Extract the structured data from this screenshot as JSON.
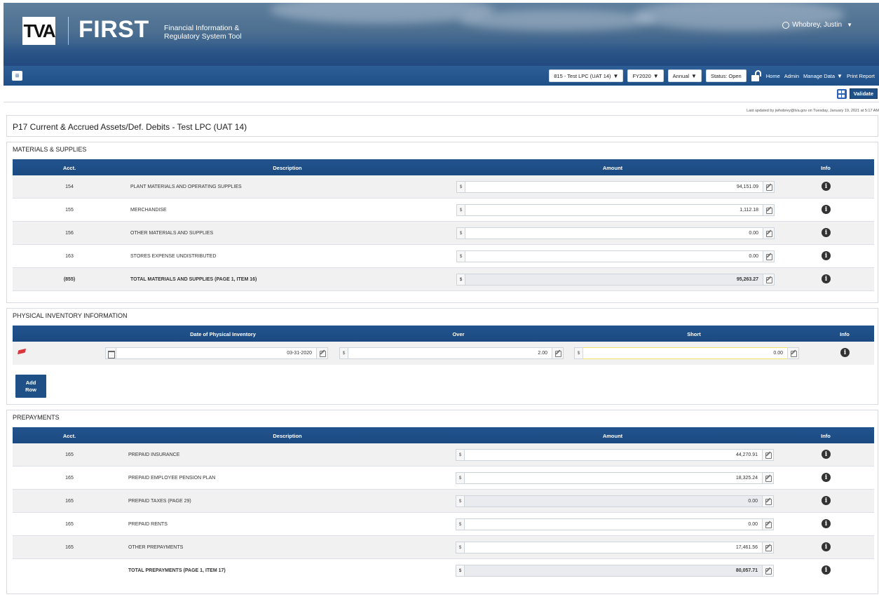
{
  "header": {
    "logo_tva": "TVA",
    "logo_first": "FIRST",
    "subtitle": "Financial Information & Regulatory System Tool",
    "user_name": "Whobrey, Justin"
  },
  "nav": {
    "entity": "815 - Test LPC (UAT 14)",
    "fiscal_year": "FY2020",
    "period": "Annual",
    "status": "Status: Open",
    "links": [
      "Home",
      "Admin",
      "Manage Data",
      "Print Report"
    ]
  },
  "toolbar": {
    "validate_label": "Validate"
  },
  "last_updated": "Last updated by jwhobrey@tva.gov on Tuesday, January 19, 2021 at 5:17 AM",
  "page_title": "P17 Current & Accrued Assets/Def. Debits - Test LPC (UAT 14)",
  "materials": {
    "title": "MATERIALS & SUPPLIES",
    "headers": {
      "acct": "Acct.",
      "desc": "Description",
      "amount": "Amount",
      "info": "Info"
    },
    "rows": [
      {
        "acct": "154",
        "desc": "PLANT MATERIALS AND OPERATING SUPPLIES",
        "amount": "94,151.09"
      },
      {
        "acct": "155",
        "desc": "MERCHANDISE",
        "amount": "1,112.18"
      },
      {
        "acct": "156",
        "desc": "OTHER MATERIALS AND SUPPLIES",
        "amount": "0.00"
      },
      {
        "acct": "163",
        "desc": "STORES EXPENSE UNDISTRIBUTED",
        "amount": "0.00"
      },
      {
        "acct": "(855)",
        "desc": "TOTAL MATERIALS AND SUPPLIES (PAGE 1, ITEM 16)",
        "amount": "95,263.27"
      }
    ],
    "currency": "$"
  },
  "inventory": {
    "title": "PHYSICAL INVENTORY INFORMATION",
    "headers": {
      "date": "Date of Physical Inventory",
      "over": "Over",
      "short": "Short",
      "info": "Info"
    },
    "row": {
      "date": "03-31-2020",
      "over": "2.00",
      "short": "0.00"
    },
    "add_row_line1": "Add",
    "add_row_line2": "Row"
  },
  "prepayments": {
    "title": "PREPAYMENTS",
    "headers": {
      "acct": "Acct.",
      "desc": "Description",
      "amount": "Amount",
      "info": "Info"
    },
    "rows": [
      {
        "acct": "165",
        "desc": "PREPAID INSURANCE",
        "amount": "44,270.91"
      },
      {
        "acct": "165",
        "desc": "PREPAID EMPLOYEE PENSION PLAN",
        "amount": "18,325.24"
      },
      {
        "acct": "165",
        "desc": "PREPAID TAXES (PAGE 29)",
        "amount": "0.00"
      },
      {
        "acct": "165",
        "desc": "PREPAID RENTS",
        "amount": "0.00"
      },
      {
        "acct": "165",
        "desc": "OTHER PREPAYMENTS",
        "amount": "17,461.56"
      },
      {
        "acct": "",
        "desc": "TOTAL PREPAYMENTS (PAGE 1, ITEM 17)",
        "amount": "80,057.71"
      }
    ]
  },
  "info_glyph": "i",
  "colors": {
    "header_blue": "#1f4f87",
    "highlight": "#efe36c"
  }
}
